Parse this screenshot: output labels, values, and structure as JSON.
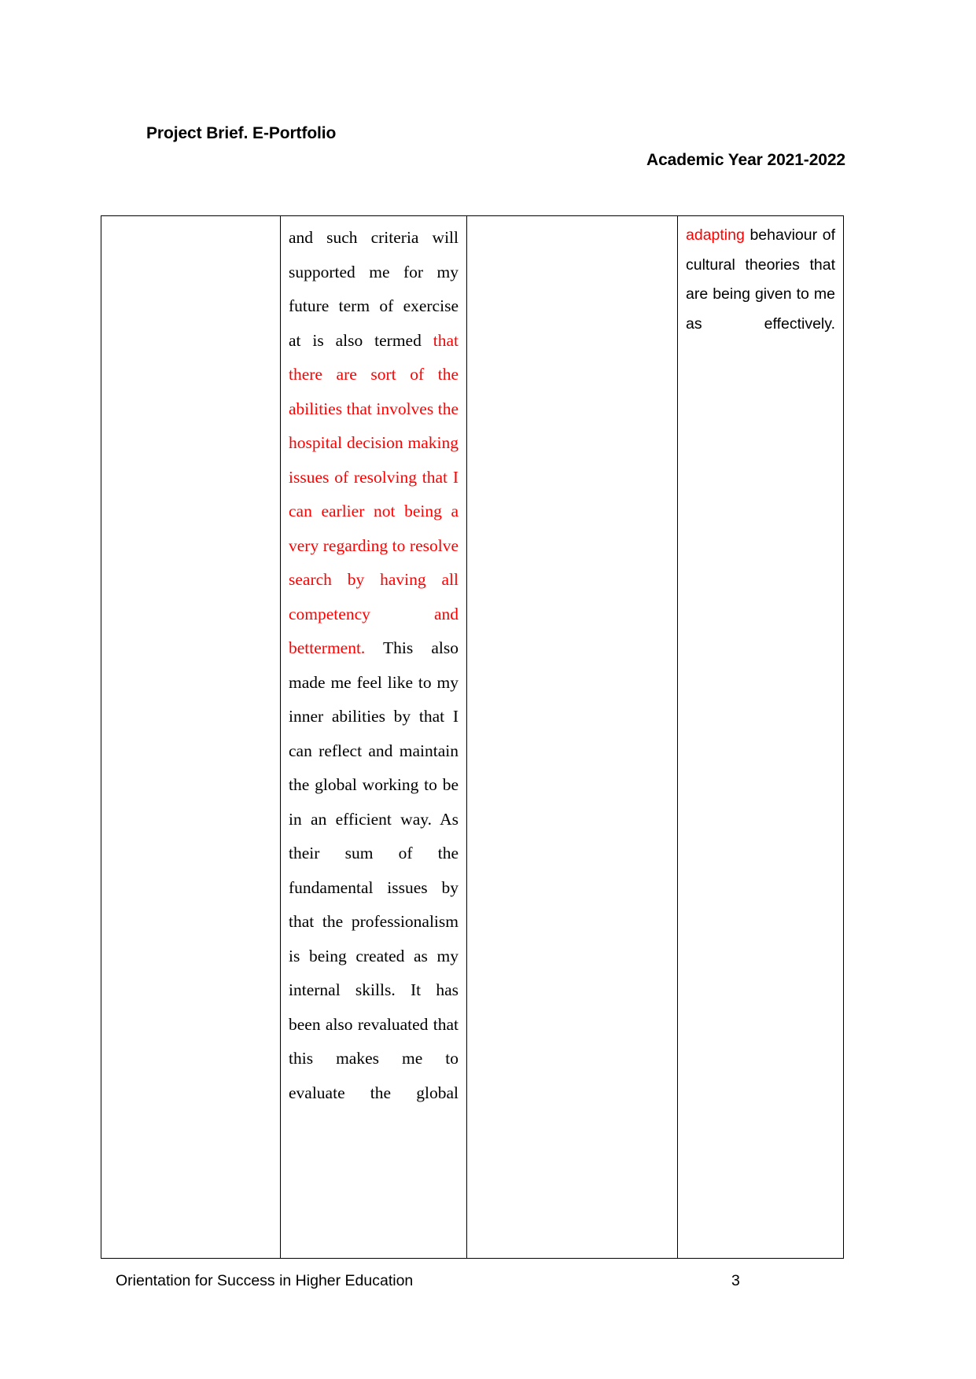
{
  "header": {
    "title": "Project Brief. E-Portfolio",
    "academic_year": "Academic Year 2021-2022"
  },
  "table": {
    "columns": 4,
    "cells": {
      "col_a": "",
      "col_b": {
        "black_lead": "and such criteria will supported me for my future term of exercise at is also termed ",
        "red_middle": "that there are sort of the abilities that involves the hospital decision making issues of resolving that I can earlier not being a very regarding to resolve search by having all competency and betterment.",
        "black_tail": " This also made me feel like to my inner abilities by that I can reflect and maintain the global working to be in an efficient way. As their sum of the fundamental issues by that the professionalism is being created as my internal skills. It has been also revaluated that this makes me to evaluate the global"
      },
      "col_c": "",
      "col_d": {
        "red_lead": "adapting",
        "black_tail": " behaviour of cultural theories that are being given to me as effectively."
      }
    }
  },
  "footer": {
    "course": "Orientation for Success in Higher Education",
    "page_number": "3"
  },
  "colors": {
    "highlight_red": "#FF0000",
    "text_black": "#000000",
    "border": "#000000",
    "background": "#FFFFFF"
  }
}
